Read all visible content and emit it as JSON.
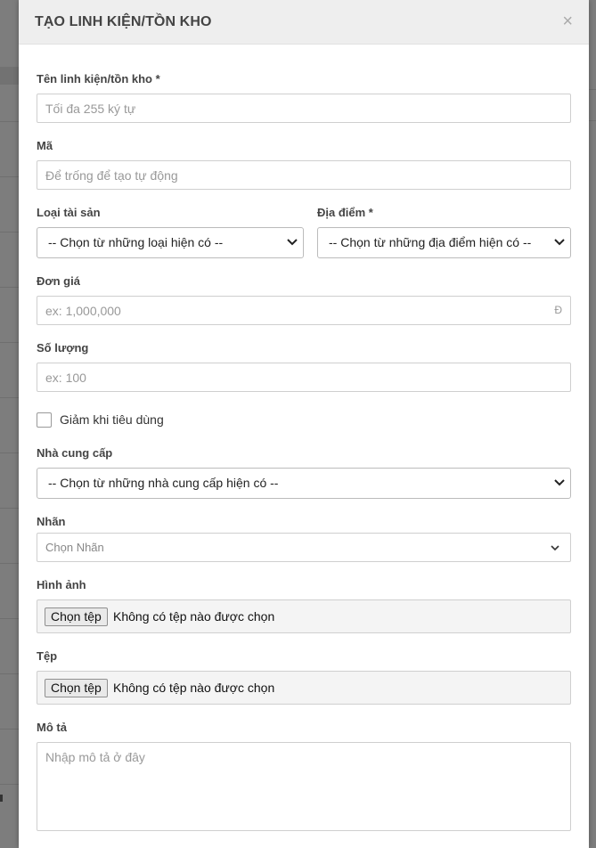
{
  "modal": {
    "title": "TẠO LINH KIỆN/TỒN KHO",
    "close_glyph": "×"
  },
  "fields": {
    "name": {
      "label": "Tên linh kiện/tồn kho *",
      "placeholder": "Tối đa 255 ký tự"
    },
    "code": {
      "label": "Mã",
      "placeholder": "Để trống để tạo tự động"
    },
    "asset_type": {
      "label": "Loại tài sản",
      "selected": "-- Chọn từ những loại hiện có --"
    },
    "location": {
      "label": "Địa điểm *",
      "selected": "-- Chọn từ những địa điểm hiện có --"
    },
    "unit_price": {
      "label": "Đơn giá",
      "placeholder": "ex: 1,000,000",
      "suffix": "Đ"
    },
    "quantity": {
      "label": "Số lượng",
      "placeholder": "ex: 100"
    },
    "decrease_on_use": {
      "label": "Giảm khi tiêu dùng",
      "checked": false
    },
    "supplier": {
      "label": "Nhà cung cấp",
      "selected": "-- Chọn từ những nhà cung cấp hiện có --"
    },
    "tags": {
      "label": "Nhãn",
      "placeholder": "Chọn Nhãn"
    },
    "image": {
      "label": "Hình ảnh",
      "button": "Chọn tệp",
      "status": "Không có tệp nào được chọn"
    },
    "file": {
      "label": "Tệp",
      "button": "Chọn tệp",
      "status": "Không có tệp nào được chọn"
    },
    "description": {
      "label": "Mô tả",
      "placeholder": "Nhập mô tả ở đây"
    }
  },
  "colors": {
    "overlay": "#7d7d7d",
    "header_bg": "#eeeeee",
    "border": "#cfcfcf"
  },
  "icons": {
    "close": "close-icon",
    "select": "chevron-down-icon"
  }
}
